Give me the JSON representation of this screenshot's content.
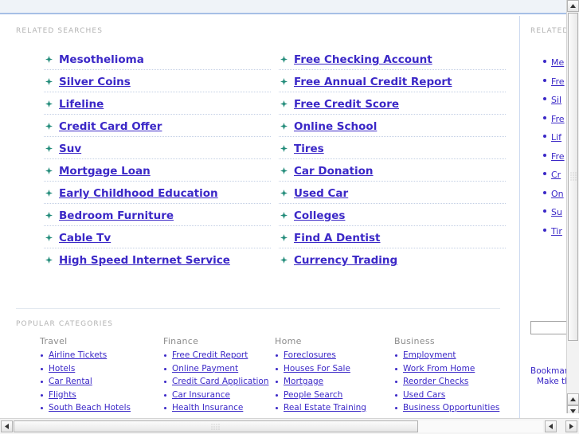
{
  "page": {
    "related_searches_label": "RELATED SEARCHES",
    "popular_categories_label": "POPULAR CATEGORIES"
  },
  "related_searches": {
    "column_left": [
      "Mesothelioma",
      "Silver Coins",
      "Lifeline",
      "Credit Card Offer",
      "Suv",
      "Mortgage Loan",
      "Early Childhood Education",
      "Bedroom Furniture",
      "Cable Tv",
      "High Speed Internet Service"
    ],
    "column_right": [
      "Free Checking Account",
      "Free Annual Credit Report",
      "Free Credit Score",
      "Online School",
      "Tires",
      "Car Donation",
      "Used Car",
      "Colleges",
      "Find A Dentist",
      "Currency Trading"
    ]
  },
  "popular_categories": [
    {
      "title": "Travel",
      "links": [
        "Airline Tickets",
        "Hotels",
        "Car Rental",
        "Flights",
        "South Beach Hotels"
      ]
    },
    {
      "title": "Finance",
      "links": [
        "Free Credit Report",
        "Online Payment",
        "Credit Card Application",
        "Car Insurance",
        "Health Insurance"
      ]
    },
    {
      "title": "Home",
      "links": [
        "Foreclosures",
        "Houses For Sale",
        "Mortgage",
        "People Search",
        "Real Estate Training"
      ]
    },
    {
      "title": "Business",
      "links": [
        "Employment",
        "Work From Home",
        "Reorder Checks",
        "Used Cars",
        "Business Opportunities"
      ]
    }
  ],
  "side_panel": {
    "label": "RELATED",
    "items": [
      "Me",
      "Fre",
      "Sil",
      "Fre",
      "Lif",
      "Fre",
      "Cr",
      "On",
      "Su",
      "Tir"
    ],
    "search_value": "",
    "search_placeholder": "",
    "footer_line_1": "Bookmark",
    "footer_line_2": "Make thi"
  },
  "colors": {
    "link": "#3b28c7",
    "bullet_green": "#1f8a78",
    "label_gray": "#b3b3b3",
    "header_band": "#eff3f8",
    "header_border": "#a6bfe6",
    "divider": "#ccd9f0"
  }
}
